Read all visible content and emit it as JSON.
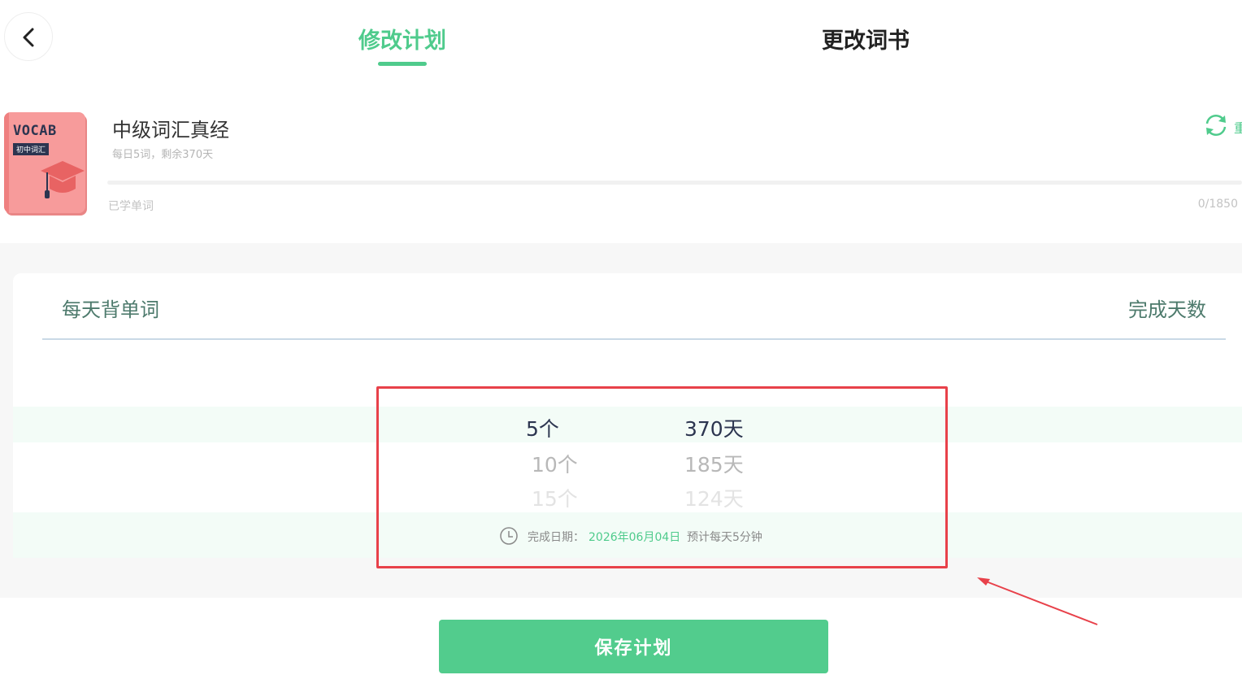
{
  "header": {
    "tabs": [
      {
        "label": "修改计划",
        "active": true
      },
      {
        "label": "更改词书",
        "active": false
      }
    ],
    "back_icon": "chevron-left-icon"
  },
  "book": {
    "cover_title": "VOCAB",
    "cover_subtitle": "初中词汇",
    "title": "中级词汇真经",
    "subtitle": "每日5词，剩余370天",
    "change_icon": "refresh-icon",
    "change_label": "重",
    "progress_label": "已学单词",
    "progress_count": "0/1850",
    "progress_fraction": 0
  },
  "plan": {
    "col_left_header": "每天背单词",
    "col_right_header": "完成天数",
    "words_options": [
      "5个",
      "10个",
      "15个"
    ],
    "days_options": [
      "370天",
      "185天",
      "124天"
    ],
    "selected_index": 0,
    "finish_label": "完成日期：",
    "finish_date": "2026年06月04日",
    "estimate": "预计每天5分钟"
  },
  "actions": {
    "save_label": "保存计划"
  },
  "colors": {
    "accent": "#4fcb8c",
    "button": "#52cc8d",
    "annotation": "#e8414a",
    "book_cover": "#f79b9b"
  }
}
